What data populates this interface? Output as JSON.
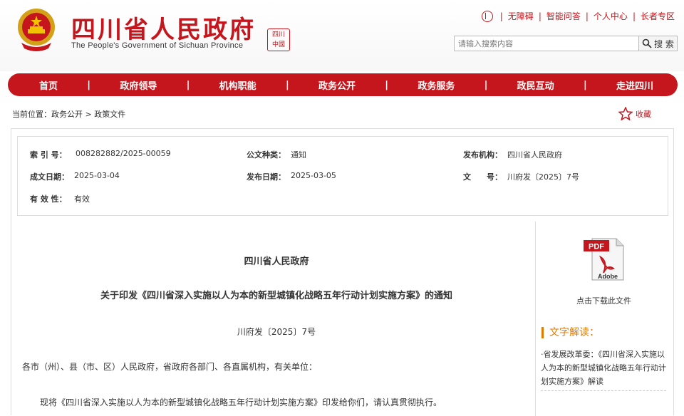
{
  "header": {
    "title": "四川省人民政府",
    "subtitle": "The People's Government of Sichuan Province",
    "seal_text": "四川中國"
  },
  "toplinks": [
    "无障碍",
    "智能问答",
    "个人中心",
    "长者专区"
  ],
  "search": {
    "placeholder": "请输入搜索内容",
    "button": "搜 索"
  },
  "nav": [
    "首页",
    "政府领导",
    "机构职能",
    "政务公开",
    "政务服务",
    "政民互动",
    "走进四川"
  ],
  "breadcrumb": {
    "prefix": "当前位置：",
    "items": [
      "政务公开",
      "政策文件"
    ],
    "sep": ">"
  },
  "favorite_label": "收藏",
  "meta": {
    "index_label": "索 引 号：",
    "index_value": "008282882/2025-00059",
    "type_label": "公文种类：",
    "type_value": "通知",
    "org_label": "发布机构：",
    "org_value": "四川省人民政府",
    "written_label": "成文日期：",
    "written_value": "2025-03-04",
    "published_label": "发布日期：",
    "published_value": "2025-03-05",
    "docno_label": "文　　号：",
    "docno_value": "川府发〔2025〕7号",
    "valid_label": "有 效 性：",
    "valid_value": "有效"
  },
  "document": {
    "org": "四川省人民政府",
    "title": "关于印发《四川省深入实施以人为本的新型城镇化战略五年行动计划实施方案》的通知",
    "number": "川府发〔2025〕7号",
    "recipients": "各市（州）、县（市、区）人民政府，省政府各部门、各直属机构，有关单位：",
    "paragraph": "现将《四川省深入实施以人为本的新型城镇化战略五年行动计划实施方案》印发给你们，请认真贯彻执行。"
  },
  "sidebar": {
    "pdf_label": "PDF",
    "adobe_label": "Adobe",
    "download": "点击下载此文件",
    "heading": "文字解读：",
    "interpretation": "·省发展改革委：《四川省深入实施以人为本的新型城镇化战略五年行动计划实施方案》解读"
  },
  "colors": {
    "brand_red": "#c4161c",
    "accent_orange": "#e07b00"
  }
}
